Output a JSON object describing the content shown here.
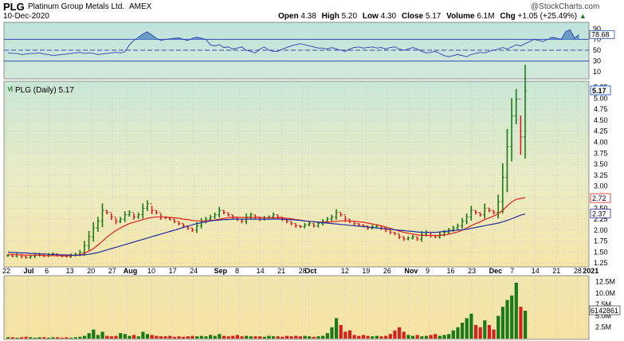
{
  "header": {
    "ticker": "PLG",
    "company": "Platinum Group Metals Ltd.",
    "exchange": "AMEX",
    "date": "10-Dec-2020",
    "watermark": "@StockCharts.com",
    "stats": [
      {
        "label": "Open",
        "value": "4.38"
      },
      {
        "label": "High",
        "value": "5.20"
      },
      {
        "label": "Low",
        "value": "4.30"
      },
      {
        "label": "Close",
        "value": "5.17"
      },
      {
        "label": "Volume",
        "value": "6.1M"
      },
      {
        "label": "Chg",
        "value": "+1.05 (+25.49%)"
      }
    ],
    "chg_arrow": "▲"
  },
  "colors": {
    "up": "#1a7a1a",
    "down": "#d42020",
    "ma_fast": "#e02020",
    "ma_slow": "#2030a0",
    "rsi_line": "#3040b0",
    "rsi_fill": "#5a8fc0",
    "price_label": "#0044cc"
  },
  "chart_data": [
    {
      "type": "line",
      "name": "RSI panel",
      "ylim": [
        0,
        100
      ],
      "ticks": [
        10,
        30,
        50,
        70,
        90
      ],
      "tick_labels": [
        "10",
        "30",
        "50",
        "70",
        "90"
      ],
      "reference_lines": [
        30,
        50,
        70
      ],
      "current_value_label": "78.68",
      "values": [
        45,
        44,
        44,
        42,
        43,
        44,
        44,
        45,
        43,
        42,
        40,
        41,
        42,
        43,
        44,
        45,
        46,
        44,
        45,
        44,
        42,
        43,
        44,
        45,
        46,
        45,
        47,
        60,
        68,
        74,
        80,
        84,
        78,
        72,
        68,
        70,
        71,
        72,
        73,
        70,
        68,
        72,
        74,
        72,
        70,
        60,
        58,
        60,
        55,
        56,
        52,
        54,
        56,
        50,
        48,
        45,
        52,
        56,
        50,
        48,
        48,
        52,
        55,
        58,
        60,
        62,
        60,
        58,
        56,
        54,
        54,
        52,
        55,
        52,
        50,
        48,
        52,
        55,
        56,
        54,
        55,
        56,
        54,
        55,
        52,
        55,
        56,
        52,
        50,
        52,
        55,
        52,
        48,
        45,
        46,
        48,
        44,
        40,
        38,
        40,
        42,
        40,
        38,
        42,
        44,
        46,
        45,
        48,
        50,
        52,
        55,
        52,
        56,
        60,
        58,
        62,
        66,
        70,
        68,
        66,
        70,
        74,
        72,
        70,
        84,
        88,
        72,
        79
      ]
    },
    {
      "type": "candlestick",
      "name": "PLG (Daily) 5.17",
      "ylim": [
        1.2,
        5.35
      ],
      "y_ticks": [
        1.25,
        1.5,
        1.75,
        2.0,
        2.25,
        2.5,
        2.75,
        3.0,
        3.25,
        3.5,
        3.75,
        4.0,
        4.25,
        4.5,
        4.75,
        5.0,
        5.25
      ],
      "y_tick_labels": [
        "1.25",
        "1.50",
        "1.75",
        "2.00",
        "2.25",
        "2.50",
        "2.75",
        "3.00",
        "3.25",
        "3.50",
        "3.75",
        "4.00",
        "4.25",
        "4.50",
        "4.75",
        "5.00",
        "5.25"
      ],
      "x_labels": [
        "22",
        "Jul",
        "6",
        "13",
        "20",
        "27",
        "Aug",
        "10",
        "17",
        "24",
        "Sep",
        "8",
        "14",
        "21",
        "28",
        "Oct",
        "12",
        "19",
        "26",
        "Nov",
        "9",
        "16",
        "23",
        "Dec",
        "7",
        "14",
        "21",
        "28",
        "2021"
      ],
      "x_label_days": [
        0,
        7,
        14,
        21,
        28,
        35,
        40,
        48,
        55,
        62,
        70,
        77,
        84,
        91,
        98,
        100,
        112,
        119,
        126,
        133,
        140,
        147,
        154,
        161,
        168,
        175,
        182,
        189,
        192
      ],
      "last_price_label": "5.17",
      "ma_labels": [
        "2.72",
        "2.37"
      ],
      "close": [
        1.42,
        1.41,
        1.44,
        1.4,
        1.38,
        1.4,
        1.43,
        1.45,
        1.42,
        1.44,
        1.46,
        1.43,
        1.41,
        1.4,
        1.43,
        1.45,
        1.5,
        1.65,
        1.85,
        2.05,
        2.2,
        2.45,
        2.4,
        2.3,
        2.2,
        2.25,
        2.35,
        2.4,
        2.3,
        2.35,
        2.5,
        2.6,
        2.45,
        2.4,
        2.3,
        2.28,
        2.25,
        2.2,
        2.15,
        2.1,
        2.05,
        2.0,
        2.1,
        2.2,
        2.25,
        2.3,
        2.35,
        2.45,
        2.4,
        2.35,
        2.3,
        2.25,
        2.2,
        2.3,
        2.35,
        2.3,
        2.25,
        2.28,
        2.3,
        2.35,
        2.3,
        2.25,
        2.2,
        2.15,
        2.1,
        2.08,
        2.12,
        2.15,
        2.1,
        2.15,
        2.2,
        2.25,
        2.3,
        2.4,
        2.35,
        2.25,
        2.2,
        2.15,
        2.12,
        2.1,
        2.05,
        2.08,
        2.1,
        2.05,
        2.0,
        1.95,
        1.92,
        1.85,
        1.8,
        1.82,
        1.85,
        1.8,
        1.9,
        1.95,
        1.88,
        1.85,
        1.9,
        1.95,
        2.0,
        2.05,
        2.1,
        2.2,
        2.3,
        2.45,
        2.4,
        2.35,
        2.5,
        2.45,
        2.4,
        2.65,
        3.2,
        3.9,
        4.6,
        4.98,
        4.12,
        5.17
      ],
      "ma_fast": [
        1.45,
        1.45,
        1.44,
        1.44,
        1.43,
        1.43,
        1.43,
        1.43,
        1.42,
        1.42,
        1.42,
        1.42,
        1.42,
        1.42,
        1.42,
        1.43,
        1.44,
        1.47,
        1.52,
        1.58,
        1.66,
        1.75,
        1.84,
        1.92,
        1.99,
        2.05,
        2.1,
        2.15,
        2.18,
        2.21,
        2.24,
        2.27,
        2.29,
        2.3,
        2.3,
        2.3,
        2.29,
        2.28,
        2.27,
        2.25,
        2.24,
        2.22,
        2.21,
        2.21,
        2.21,
        2.22,
        2.23,
        2.25,
        2.27,
        2.28,
        2.29,
        2.29,
        2.29,
        2.29,
        2.29,
        2.29,
        2.29,
        2.28,
        2.28,
        2.28,
        2.28,
        2.28,
        2.27,
        2.26,
        2.24,
        2.23,
        2.21,
        2.2,
        2.19,
        2.18,
        2.18,
        2.18,
        2.19,
        2.2,
        2.21,
        2.21,
        2.21,
        2.2,
        2.19,
        2.18,
        2.16,
        2.14,
        2.12,
        2.1,
        2.07,
        2.04,
        2.01,
        1.98,
        1.95,
        1.93,
        1.91,
        1.89,
        1.88,
        1.88,
        1.88,
        1.88,
        1.88,
        1.89,
        1.91,
        1.93,
        1.96,
        2.0,
        2.05,
        2.1,
        2.15,
        2.19,
        2.24,
        2.28,
        2.32,
        2.37,
        2.45,
        2.55,
        2.64,
        2.7,
        2.72,
        2.74
      ],
      "ma_slow": [
        1.5,
        1.49,
        1.49,
        1.48,
        1.48,
        1.47,
        1.47,
        1.46,
        1.46,
        1.45,
        1.45,
        1.44,
        1.44,
        1.44,
        1.43,
        1.43,
        1.43,
        1.44,
        1.45,
        1.47,
        1.49,
        1.52,
        1.55,
        1.58,
        1.61,
        1.64,
        1.67,
        1.7,
        1.73,
        1.76,
        1.79,
        1.82,
        1.85,
        1.88,
        1.91,
        1.94,
        1.97,
        2.0,
        2.03,
        2.06,
        2.09,
        2.12,
        2.15,
        2.17,
        2.19,
        2.21,
        2.22,
        2.23,
        2.24,
        2.24,
        2.25,
        2.25,
        2.25,
        2.25,
        2.25,
        2.25,
        2.25,
        2.25,
        2.25,
        2.25,
        2.25,
        2.25,
        2.24,
        2.24,
        2.23,
        2.22,
        2.21,
        2.2,
        2.19,
        2.18,
        2.17,
        2.16,
        2.15,
        2.14,
        2.13,
        2.12,
        2.11,
        2.1,
        2.09,
        2.08,
        2.07,
        2.06,
        2.05,
        2.04,
        2.03,
        2.02,
        2.01,
        2.0,
        1.99,
        1.98,
        1.97,
        1.96,
        1.95,
        1.95,
        1.95,
        1.95,
        1.96,
        1.97,
        1.98,
        1.99,
        2.0,
        2.01,
        2.02,
        2.04,
        2.06,
        2.08,
        2.1,
        2.12,
        2.14,
        2.16,
        2.19,
        2.22,
        2.26,
        2.3,
        2.34,
        2.37
      ]
    },
    {
      "type": "bar",
      "name": "Volume",
      "ylim": [
        0,
        13.5
      ],
      "y_ticks": [
        2.5,
        5.0,
        7.5,
        10.0,
        12.5
      ],
      "y_tick_labels": [
        "2.5M",
        "5.0M",
        "7.5M",
        "10.0M",
        "12.5M"
      ],
      "current_volume_label": "6142861",
      "values": [
        0.3,
        0.3,
        0.2,
        0.3,
        0.4,
        0.3,
        0.2,
        0.3,
        0.3,
        0.2,
        0.3,
        0.3,
        0.2,
        0.3,
        0.2,
        0.3,
        0.4,
        0.6,
        1.2,
        2.0,
        0.8,
        1.5,
        0.6,
        0.5,
        0.6,
        1.2,
        1.0,
        0.6,
        0.8,
        0.5,
        1.5,
        1.0,
        0.8,
        0.6,
        0.5,
        0.5,
        0.6,
        0.4,
        0.5,
        0.4,
        0.5,
        0.6,
        0.5,
        0.6,
        0.5,
        0.8,
        0.6,
        1.0,
        0.6,
        0.5,
        0.6,
        0.8,
        0.5,
        0.6,
        0.5,
        0.5,
        0.5,
        0.4,
        0.6,
        0.5,
        0.5,
        0.4,
        0.6,
        0.5,
        0.6,
        0.5,
        0.6,
        0.5,
        0.4,
        0.5,
        0.6,
        1.2,
        2.5,
        4.5,
        3.0,
        1.5,
        1.8,
        0.8,
        0.6,
        0.8,
        0.6,
        0.5,
        0.6,
        0.5,
        0.6,
        1.0,
        1.8,
        2.5,
        1.5,
        0.8,
        0.6,
        0.8,
        0.5,
        0.6,
        0.8,
        1.0,
        0.6,
        0.8,
        1.0,
        1.8,
        2.5,
        3.5,
        4.5,
        5.5,
        3.0,
        2.5,
        4.0,
        3.0,
        2.0,
        5.0,
        7.0,
        8.5,
        9.5,
        12.3,
        7.0,
        6.14
      ]
    }
  ]
}
